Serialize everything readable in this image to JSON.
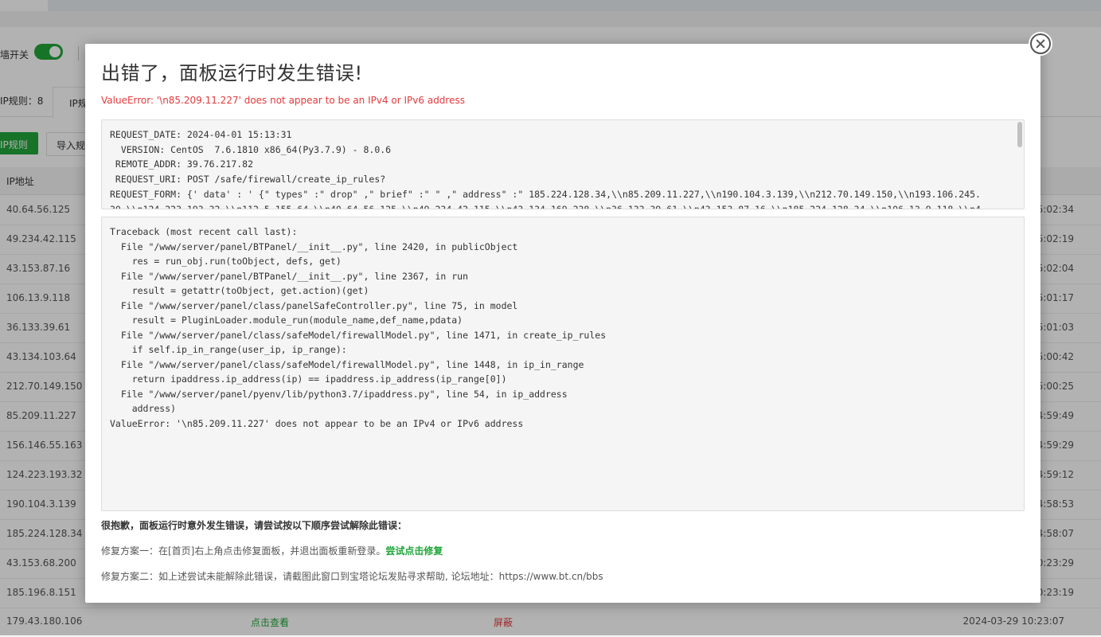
{
  "background": {
    "switch_label": "墙开关",
    "tab_rules_count": "IP规则：8",
    "tab_ip_rules": "IP规",
    "btn_add_ip_rule": "IP规则",
    "btn_import": "导入规",
    "col_ip": "IP地址",
    "rows": [
      {
        "ip": "40.64.56.125",
        "time": "5:02:34"
      },
      {
        "ip": "49.234.42.115",
        "time": "5:02:19"
      },
      {
        "ip": "43.153.87.16",
        "time": "5:02:04"
      },
      {
        "ip": "106.13.9.118",
        "time": "5:01:17"
      },
      {
        "ip": "36.133.39.61",
        "time": "5:01:03"
      },
      {
        "ip": "43.134.103.64",
        "time": "5:00:42"
      },
      {
        "ip": "212.70.149.150",
        "time": "5:00:25"
      },
      {
        "ip": "85.209.11.227",
        "time": "4:59:49"
      },
      {
        "ip": "156.146.55.163",
        "time": "4:59:29"
      },
      {
        "ip": "124.223.193.32",
        "time": "4:59:12"
      },
      {
        "ip": "190.104.3.139",
        "time": "4:58:53"
      },
      {
        "ip": "185.224.128.34",
        "time": "4:58:07"
      },
      {
        "ip": "43.153.68.200",
        "time": "0:23:29"
      },
      {
        "ip": "185.196.8.151",
        "time": "0:23:19"
      }
    ],
    "last_row": {
      "ip": "179.43.180.106",
      "view": "点击查看",
      "action": "屏蔽",
      "time": "2024-03-29 10:23:07"
    }
  },
  "modal": {
    "title": "出错了，面板运行时发生错误!",
    "error_line": "ValueError: '\\n85.209.11.227' does not appear to be an IPv4 or IPv6 address",
    "request_info": "REQUEST_DATE: 2024-04-01 15:13:31\n  VERSION: CentOS  7.6.1810 x86_64(Py3.7.9) - 8.0.6\n REMOTE_ADDR: 39.76.217.82\n REQUEST_URI: POST /safe/firewall/create_ip_rules?\nREQUEST_FORM: {' data' : ' {\" types\" :\" drop\" ,\" brief\" :\" \" ,\" address\" :\" 185.224.128.34,\\\\n85.209.11.227,\\\\n190.104.3.139,\\\\n212.70.149.150,\\\\n193.106.245.\n30,\\\\n124.223.193.32,\\\\n112.5.155.64,\\\\n40.64.56.125,\\\\n49.234.42.115,\\\\n43.134.169.238,\\\\n36.133.39.61,\\\\n43.153.87.16,\\\\n185.224.128.34,\\\\n106.13.9.118,\\\\n4",
    "traceback": "Traceback (most recent call last):\n  File \"/www/server/panel/BTPanel/__init__.py\", line 2420, in publicObject\n    res = run_obj.run(toObject, defs, get)\n  File \"/www/server/panel/BTPanel/__init__.py\", line 2367, in run\n    result = getattr(toObject, get.action)(get)\n  File \"/www/server/panel/class/panelSafeController.py\", line 75, in model\n    result = PluginLoader.module_run(module_name,def_name,pdata)\n  File \"/www/server/panel/class/safeModel/firewallModel.py\", line 1471, in create_ip_rules\n    if self.ip_in_range(user_ip, ip_range):\n  File \"/www/server/panel/class/safeModel/firewallModel.py\", line 1448, in ip_in_range\n    return ipaddress.ip_address(ip) == ipaddress.ip_address(ip_range[0])\n  File \"/www/server/panel/pyenv/lib/python3.7/ipaddress.py\", line 54, in ip_address\n    address)\nValueError: '\\n85.209.11.227' does not appear to be an IPv4 or IPv6 address",
    "sorry_text": "很抱歉，面板运行时意外发生错误，请尝试按以下顺序尝试解除此错误：",
    "fix1_text": "修复方案一：在[首页]右上角点击修复面板，并退出面板重新登录。",
    "fix1_link": "尝试点击修复",
    "fix2_text": "修复方案二：如上述尝试未能解除此错误，请截图此窗口到宝塔论坛发贴寻求帮助, 论坛地址：https://www.bt.cn/bbs",
    "close_icon": "close-circle-icon"
  },
  "colors": {
    "accent_green": "#20a53a",
    "error_red": "#e4393c"
  }
}
